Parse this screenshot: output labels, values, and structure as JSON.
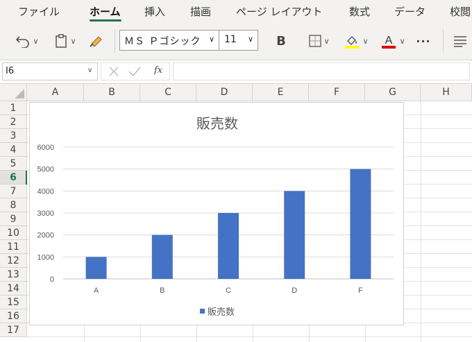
{
  "ribbon_tabs": [
    {
      "label": "ファイル",
      "active": false
    },
    {
      "label": "ホーム",
      "active": true
    },
    {
      "label": "挿入",
      "active": false
    },
    {
      "label": "描画",
      "active": false
    },
    {
      "label": "ページ レイアウト",
      "active": false
    },
    {
      "label": "数式",
      "active": false
    },
    {
      "label": "データ",
      "active": false
    },
    {
      "label": "校閲",
      "active": false
    }
  ],
  "toolbar": {
    "font_name": "ＭＳ Ｐゴシック",
    "font_size": "11",
    "bold_label": "B",
    "more_label": "···",
    "icons": [
      "undo-icon",
      "paste-icon",
      "format-painter-icon",
      "borders-icon",
      "fill-color-icon",
      "font-color-icon",
      "align-icon"
    ],
    "fill_color": "#ffff00",
    "font_color": "#e00000"
  },
  "formula_bar": {
    "cell_ref": "I6",
    "fx_label": "fx",
    "value": ""
  },
  "sheet": {
    "columns": [
      "A",
      "B",
      "C",
      "D",
      "E",
      "F",
      "G",
      "H"
    ],
    "rows": [
      "1",
      "2",
      "3",
      "4",
      "5",
      "6",
      "7",
      "8",
      "9",
      "10",
      "11",
      "12",
      "13",
      "14",
      "15",
      "16",
      "17"
    ],
    "selected_row": "6"
  },
  "chart_data": {
    "type": "bar",
    "title": "販売数",
    "categories": [
      "A",
      "B",
      "C",
      "D",
      "F"
    ],
    "series": [
      {
        "name": "販売数",
        "values": [
          1000,
          2000,
          3000,
          4000,
          5000
        ],
        "color": "#4472c4"
      }
    ],
    "ylim": [
      0,
      6000
    ],
    "yticks": [
      "0",
      "1000",
      "2000",
      "3000",
      "4000",
      "5000",
      "6000"
    ],
    "grid": true,
    "legend": "bottom"
  }
}
